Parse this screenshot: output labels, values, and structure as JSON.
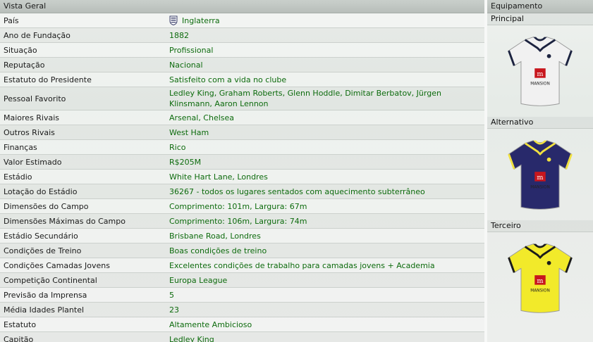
{
  "left_panel": {
    "title": "Vista Geral"
  },
  "overview": [
    {
      "label": "País",
      "value": "Inglaterra",
      "flag_icon": "england-crest-icon"
    },
    {
      "label": "Ano de Fundação",
      "value": "1882"
    },
    {
      "label": "Situação",
      "value": "Profissional"
    },
    {
      "label": "Reputação",
      "value": "Nacional"
    },
    {
      "label": "Estatuto do Presidente",
      "value": "Satisfeito com a vida no clube"
    },
    {
      "label": "Pessoal Favorito",
      "value": "Ledley King, Graham Roberts, Glenn Hoddle, Dimitar Berbatov, Jürgen Klinsmann, Aaron Lennon"
    },
    {
      "label": "Maiores Rivais",
      "value": "Arsenal, Chelsea"
    },
    {
      "label": "Outros Rivais",
      "value": "West Ham"
    },
    {
      "label": "Finanças",
      "value": "Rico"
    },
    {
      "label": "Valor Estimado",
      "value": "R$205M"
    },
    {
      "label": "Estádio",
      "value": "White Hart Lane, Londres"
    },
    {
      "label": "Lotação do Estádio",
      "value": "36267 - todos os lugares sentados com aquecimento subterrâneo"
    },
    {
      "label": "Dimensões do Campo",
      "value": "Comprimento: 101m, Largura: 67m"
    },
    {
      "label": "Dimensões Máximas do Campo",
      "value": "Comprimento: 106m, Largura: 74m"
    },
    {
      "label": "Estádio Secundário",
      "value": "Brisbane Road, Londres"
    },
    {
      "label": "Condições de Treino",
      "value": "Boas condições de treino"
    },
    {
      "label": "Condições Camadas Jovens",
      "value": "Excelentes condições de trabalho para camadas jovens + Academia"
    },
    {
      "label": "Competição Continental",
      "value": "Europa League"
    },
    {
      "label": "Previsão da Imprensa",
      "value": "5"
    },
    {
      "label": "Média Idades Plantel",
      "value": "23"
    },
    {
      "label": "Estatuto",
      "value": "Altamente Ambicioso"
    },
    {
      "label": "Capitão",
      "value": "Ledley King"
    }
  ],
  "right_panel": {
    "title": "Equipamento"
  },
  "kits": [
    {
      "label": "Principal",
      "icon": "home-kit-shirt-icon",
      "body": "#f1f1f1",
      "trim": "#1c2340",
      "sponsor": "MANSION"
    },
    {
      "label": "Alternativo",
      "icon": "away-kit-shirt-icon",
      "body": "#28296b",
      "trim": "#f0e040",
      "sponsor": "MANSION"
    },
    {
      "label": "Terceiro",
      "icon": "third-kit-shirt-icon",
      "body": "#f2ea2a",
      "trim": "#1b1b1b",
      "sponsor": "MANSION"
    }
  ],
  "colors": {
    "value_text": "#0d6b0d",
    "sponsor_red": "#c8161d"
  }
}
